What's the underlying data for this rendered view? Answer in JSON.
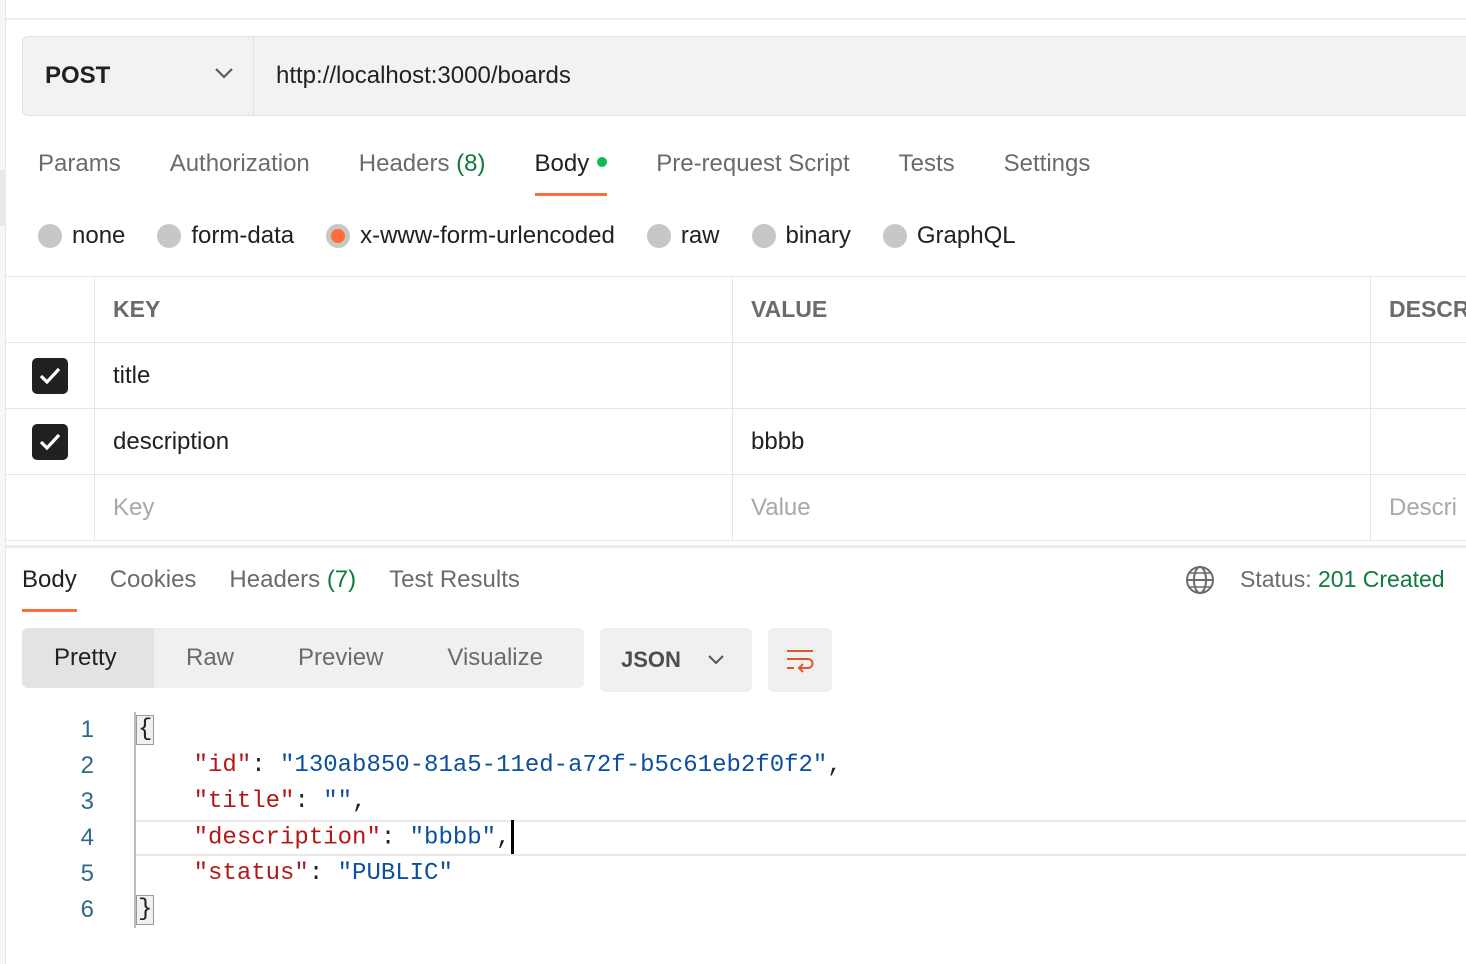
{
  "request": {
    "method": "POST",
    "url": "http://localhost:3000/boards",
    "tabs": [
      {
        "label": "Params"
      },
      {
        "label": "Authorization"
      },
      {
        "label": "Headers",
        "count": "(8)"
      },
      {
        "label": "Body"
      },
      {
        "label": "Pre-request Script"
      },
      {
        "label": "Tests"
      },
      {
        "label": "Settings"
      }
    ],
    "active_tab": "Body",
    "body_types": [
      "none",
      "form-data",
      "x-www-form-urlencoded",
      "raw",
      "binary",
      "GraphQL"
    ],
    "selected_body_type": "x-www-form-urlencoded",
    "table": {
      "headers": {
        "key": "KEY",
        "value": "VALUE",
        "description": "DESCR"
      },
      "rows": [
        {
          "key": "title",
          "value": "",
          "checked": true
        },
        {
          "key": "description",
          "value": "bbbb",
          "checked": true
        }
      ],
      "placeholders": {
        "key": "Key",
        "value": "Value",
        "description": "Descri"
      }
    }
  },
  "response": {
    "tabs": [
      {
        "label": "Body"
      },
      {
        "label": "Cookies"
      },
      {
        "label": "Headers",
        "count": "(7)"
      },
      {
        "label": "Test Results"
      }
    ],
    "active_tab": "Body",
    "status_label": "Status:",
    "status_value": "201 Created",
    "view_modes": [
      "Pretty",
      "Raw",
      "Preview",
      "Visualize"
    ],
    "active_view": "Pretty",
    "format": "JSON",
    "code_lines": [
      "1",
      "2",
      "3",
      "4",
      "5",
      "6"
    ],
    "json": {
      "open": "{",
      "close": "}",
      "id_key": "\"id\"",
      "id_val": "\"130ab850-81a5-11ed-a72f-b5c61eb2f0f2\"",
      "title_key": "\"title\"",
      "title_val": "\"\"",
      "description_key": "\"description\"",
      "description_val": "\"bbbb\"",
      "status_key": "\"status\"",
      "status_val": "\"PUBLIC\""
    }
  },
  "colors": {
    "accent": "#ff6c37",
    "success": "#0f7a3e",
    "dot": "#0cbb52"
  },
  "icons": [
    "chevron-down-icon",
    "check-icon",
    "globe-icon",
    "wrap-lines-icon"
  ]
}
